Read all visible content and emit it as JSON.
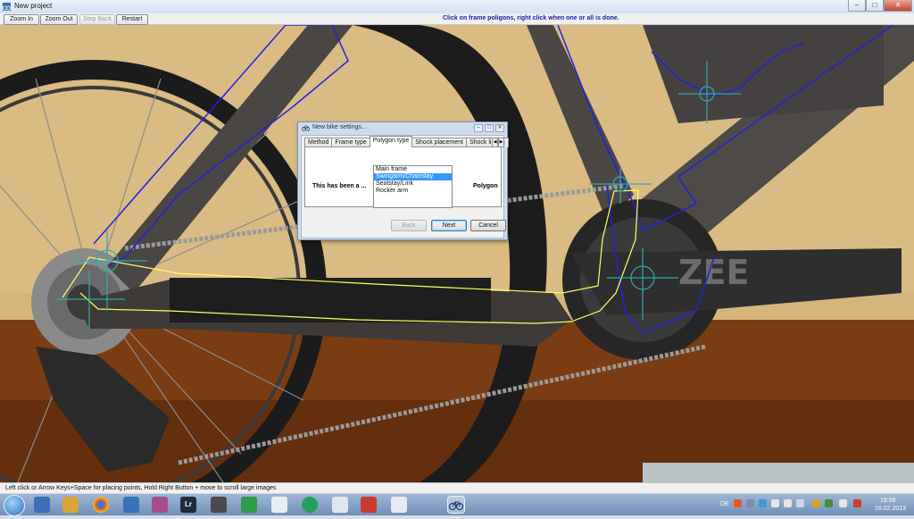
{
  "window": {
    "title": "New project",
    "controls": {
      "minimize": "–",
      "maximize": "□",
      "close": "✕"
    }
  },
  "toolbar": {
    "zoom_in": "Zoom In",
    "zoom_out": "Zoom Out",
    "step_back": "Step Back",
    "restart": "Restart",
    "instruction": "Click on frame poligons, right click when one or all is done."
  },
  "status_bar": {
    "text": "Left click or Arrow Keys+Space for placing points, Hold Right Button + move to scroll large images"
  },
  "dialog": {
    "title": "New bike settings...",
    "tabs": [
      "Method",
      "Frame type",
      "Polygon type",
      "Shock placement",
      "Shock linkag"
    ],
    "active_tab": "Polygon type",
    "label_left": "This has been a ...",
    "label_right": "Polygon",
    "polygon_types": [
      "Main frame",
      "Swingarm/Chainstay",
      "Seatstay/Link",
      "Rocker arm"
    ],
    "selected_type": "Swingarm/Chainstay",
    "buttons": {
      "back": "Back",
      "next": "Next",
      "cancel": "Cancel"
    }
  },
  "taskbar": {
    "language": "DE",
    "time": "19:58",
    "date": "16.02.2013",
    "pinned_icons": [
      "start-orb",
      "explorer-icon",
      "file-manager-icon",
      "chrome-icon",
      "thunderbird-icon",
      "archive-icon",
      "lightroom-icon",
      "monitor-icon",
      "spreadsheet-icon",
      "document-icon",
      "globe-icon",
      "window-icon",
      "pdf-icon",
      "presentation-icon",
      "bike-app-icon"
    ],
    "lightroom_label": "Lr"
  },
  "colors": {
    "swingarm_polygon": "#ffff66",
    "main_frame_polygon": "#2222dd",
    "pivot_marker": "#33aaaa",
    "instruction_text": "#1a1aa8",
    "selection": "#3399ff"
  }
}
